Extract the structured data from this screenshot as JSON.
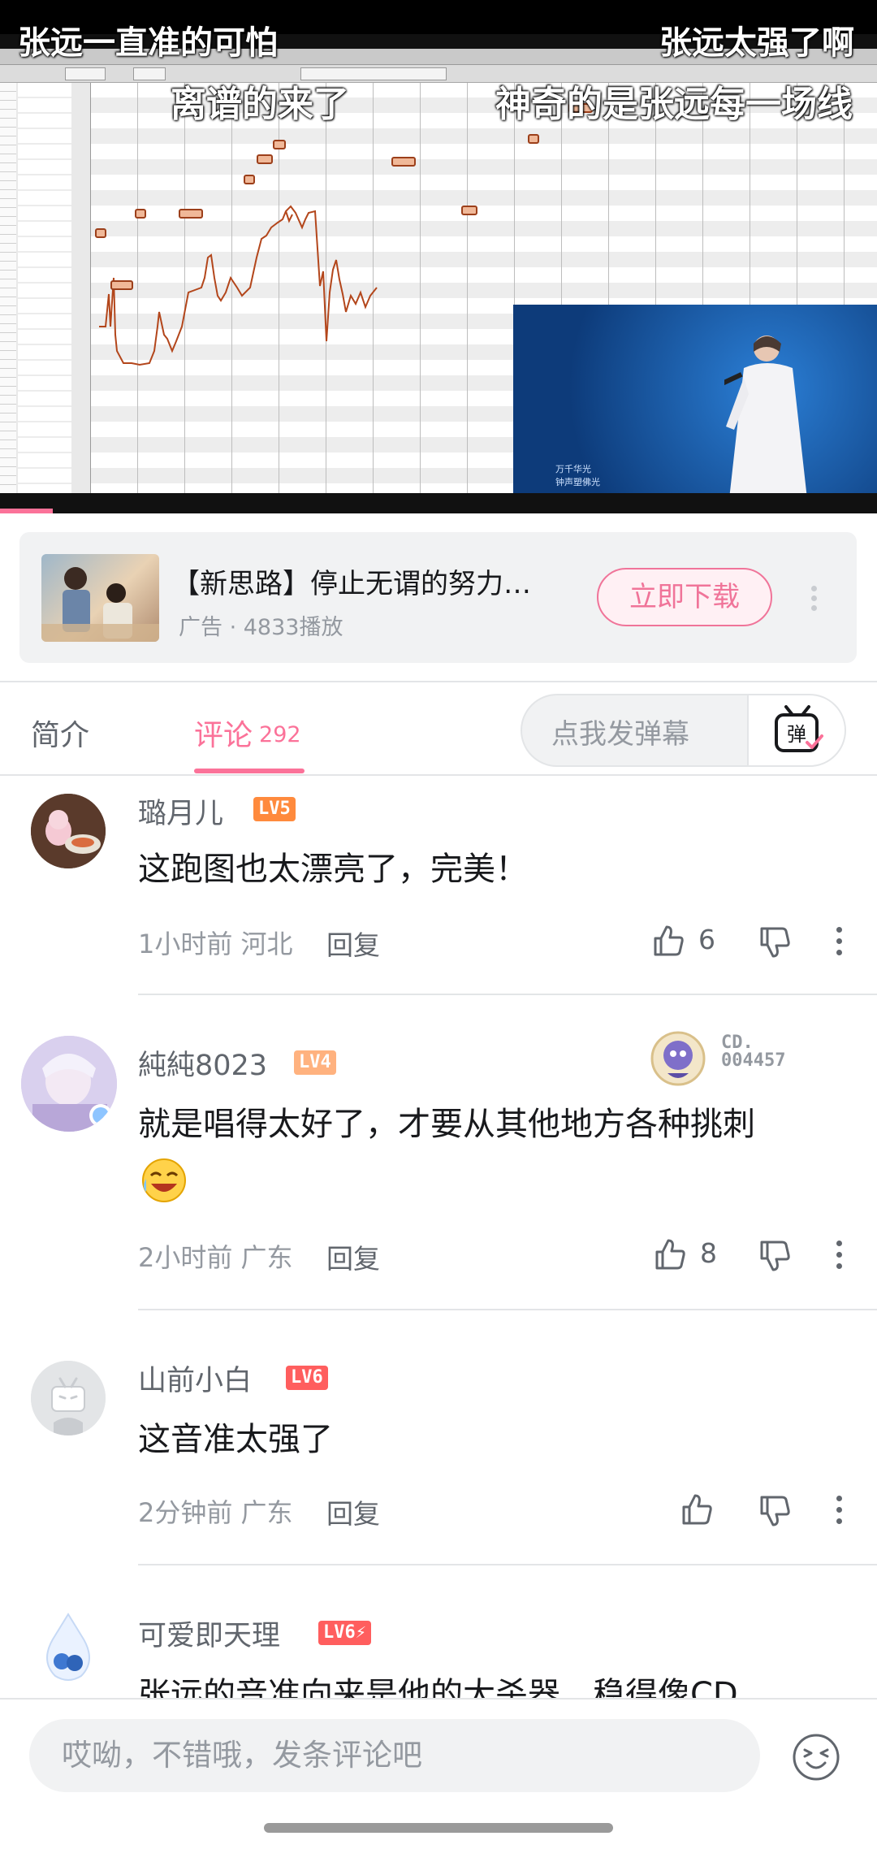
{
  "video": {
    "danmaku": [
      "张远一直准的可怕",
      "张远太强了啊",
      "离谱的来了",
      "神奇的是张远每一场线"
    ],
    "pip_caption_line1": "万千华光",
    "pip_caption_line2": "钟声塑佛光",
    "playback_progress": 0.06
  },
  "ad": {
    "title": "【新思路】停止无谓的努力…",
    "meta": "广告 · 4833播放",
    "download_label": "立即下载"
  },
  "tabs": {
    "intro_label": "简介",
    "comments_label": "评论",
    "comments_count": "292",
    "danmaku_placeholder": "点我发弹幕",
    "danmaku_button_label": "弹"
  },
  "comments": [
    {
      "username": "璐月儿",
      "level": "LV5",
      "content": "这跑图也太漂亮了，完美！",
      "time_location": "1小时前 河北",
      "reply_label": "回复",
      "likes": "6"
    },
    {
      "username": "純純8023",
      "level": "LV4",
      "badge_number": "CD.\n004457",
      "content": "就是唱得太好了，才要从其他地方各种挑刺",
      "time_location": "2小时前 广东",
      "reply_label": "回复",
      "likes": "8"
    },
    {
      "username": "山前小白",
      "level": "LV6",
      "content": "这音准太强了",
      "time_location": "2分钟前 广东",
      "reply_label": "回复",
      "likes": ""
    },
    {
      "username": "可爱即天理",
      "level": "LV6",
      "content": "张远的音准向来是他的大杀器，稳得像CD"
    }
  ],
  "composer": {
    "placeholder": "哎呦，不错哦，发条评论吧"
  },
  "colors": {
    "accent_pink": "#fb7299",
    "lv4_orange": "#ffb27f",
    "lv5_orange": "#ff8a3d",
    "lv6_red": "#ff5e5e",
    "text_gray": "#9499a0"
  },
  "icons": {
    "like": "thumbs-up-icon",
    "dislike": "thumbs-down-icon",
    "more": "more-vertical-icon",
    "emoji": "emoji-face-icon",
    "danmaku_toggle": "tv-danmaku-icon"
  }
}
